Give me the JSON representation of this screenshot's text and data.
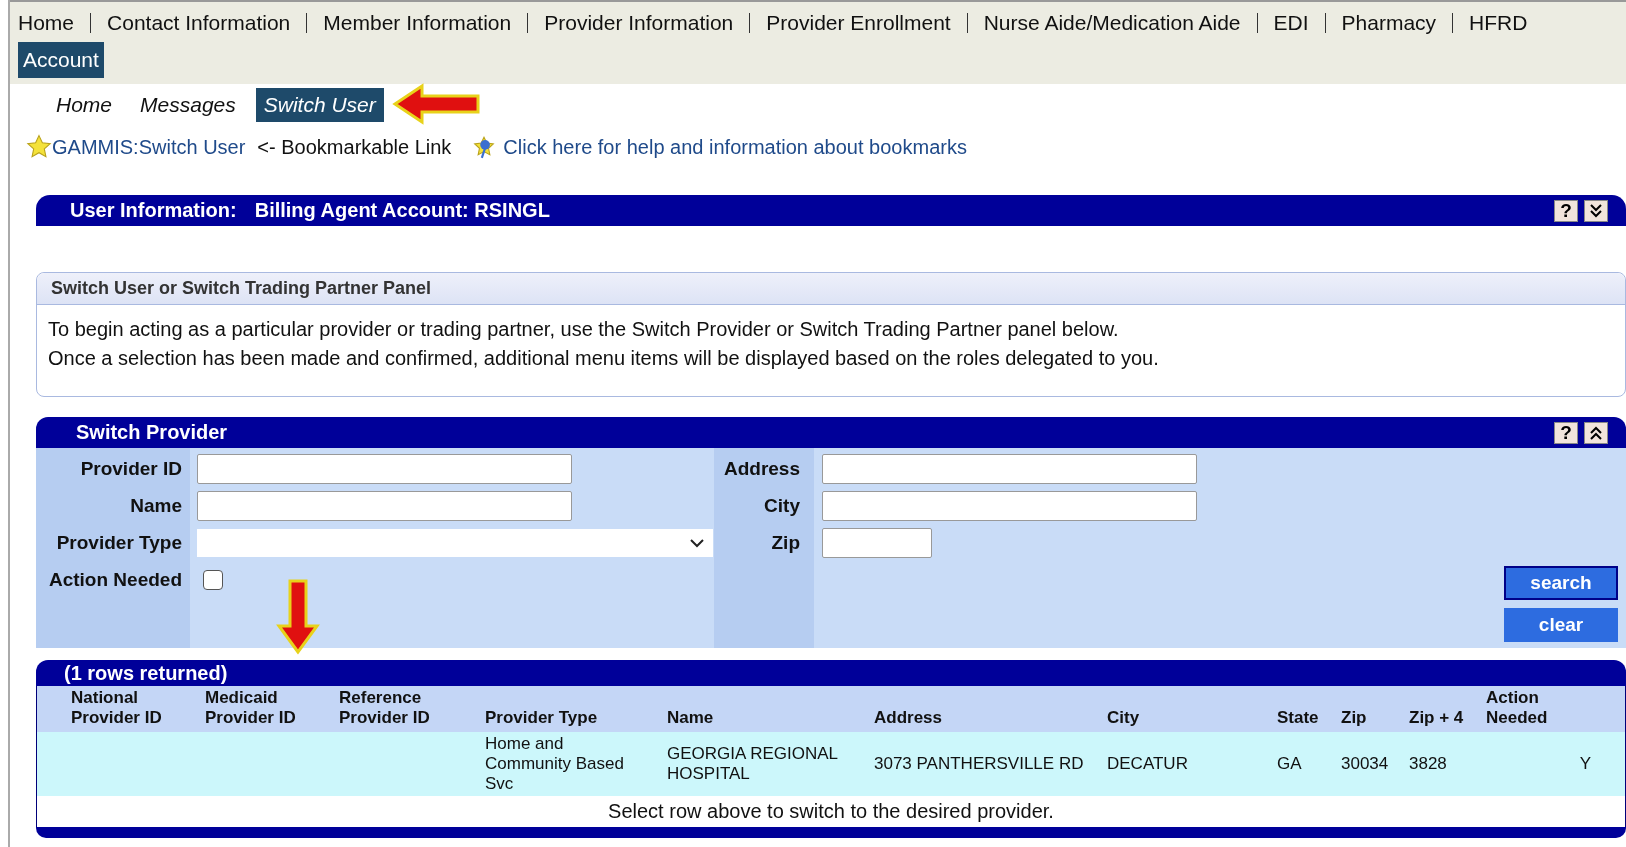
{
  "top_nav": [
    {
      "label": "Home"
    },
    {
      "label": "Contact Information"
    },
    {
      "label": "Member Information"
    },
    {
      "label": "Provider Information"
    },
    {
      "label": "Provider Enrollment"
    },
    {
      "label": "Nurse Aide/Medication Aide"
    },
    {
      "label": "EDI"
    },
    {
      "label": "Pharmacy"
    },
    {
      "label": "HFRD"
    }
  ],
  "account_tab": {
    "label": "Account",
    "selected": true
  },
  "sub_nav": [
    {
      "label": "Home",
      "selected": false
    },
    {
      "label": "Messages",
      "selected": false
    },
    {
      "label": "Switch User",
      "selected": true
    }
  ],
  "bookmark": {
    "link": "GAMMIS:Switch User",
    "note": "<- Bookmarkable Link",
    "help_link": "Click here for help and information about bookmarks"
  },
  "user_info_bar": {
    "label": "User Information:",
    "value": "Billing Agent Account: RSINGL",
    "help": "?",
    "expanded": false
  },
  "info_panel": {
    "title": "Switch User or Switch Trading Partner Panel",
    "lines": [
      "To begin acting as a particular provider or trading partner, use the Switch Provider or Switch Trading Partner panel below.",
      "Once a selection has been made and confirmed, additional menu items will be displayed based on the roles delegated to you."
    ]
  },
  "switch_provider": {
    "title": "Switch Provider",
    "help": "?",
    "expanded": true,
    "left_fields": [
      {
        "label": "Provider ID",
        "kind": "text"
      },
      {
        "label": "Name",
        "kind": "text"
      },
      {
        "label": "Provider Type",
        "kind": "select"
      },
      {
        "label": "Action Needed",
        "kind": "checkbox",
        "checked": false
      }
    ],
    "right_fields": [
      {
        "label": "Address",
        "kind": "text"
      },
      {
        "label": "City",
        "kind": "text"
      },
      {
        "label": "Zip",
        "kind": "short"
      }
    ],
    "buttons": [
      {
        "label": "search",
        "focused": true
      },
      {
        "label": "clear",
        "focused": false
      }
    ]
  },
  "results": {
    "title": "(1 rows returned)",
    "columns": [
      "National\nProvider ID",
      "Medicaid\nProvider ID",
      "Reference\nProvider ID",
      "Provider Type",
      "Name",
      "Address",
      "City",
      "State",
      "Zip",
      "Zip + 4",
      "Action\nNeeded"
    ],
    "rows": [
      {
        "cells": [
          "",
          "",
          "",
          "Home and\nCommunity Based\nSvc",
          "GEORGIA REGIONAL\nHOSPITAL",
          "3073 PANTHERSVILLE RD",
          "DECATUR",
          "GA",
          "30034",
          "3828",
          "Y"
        ]
      }
    ],
    "footer": "Select row above to switch to the desired provider."
  }
}
